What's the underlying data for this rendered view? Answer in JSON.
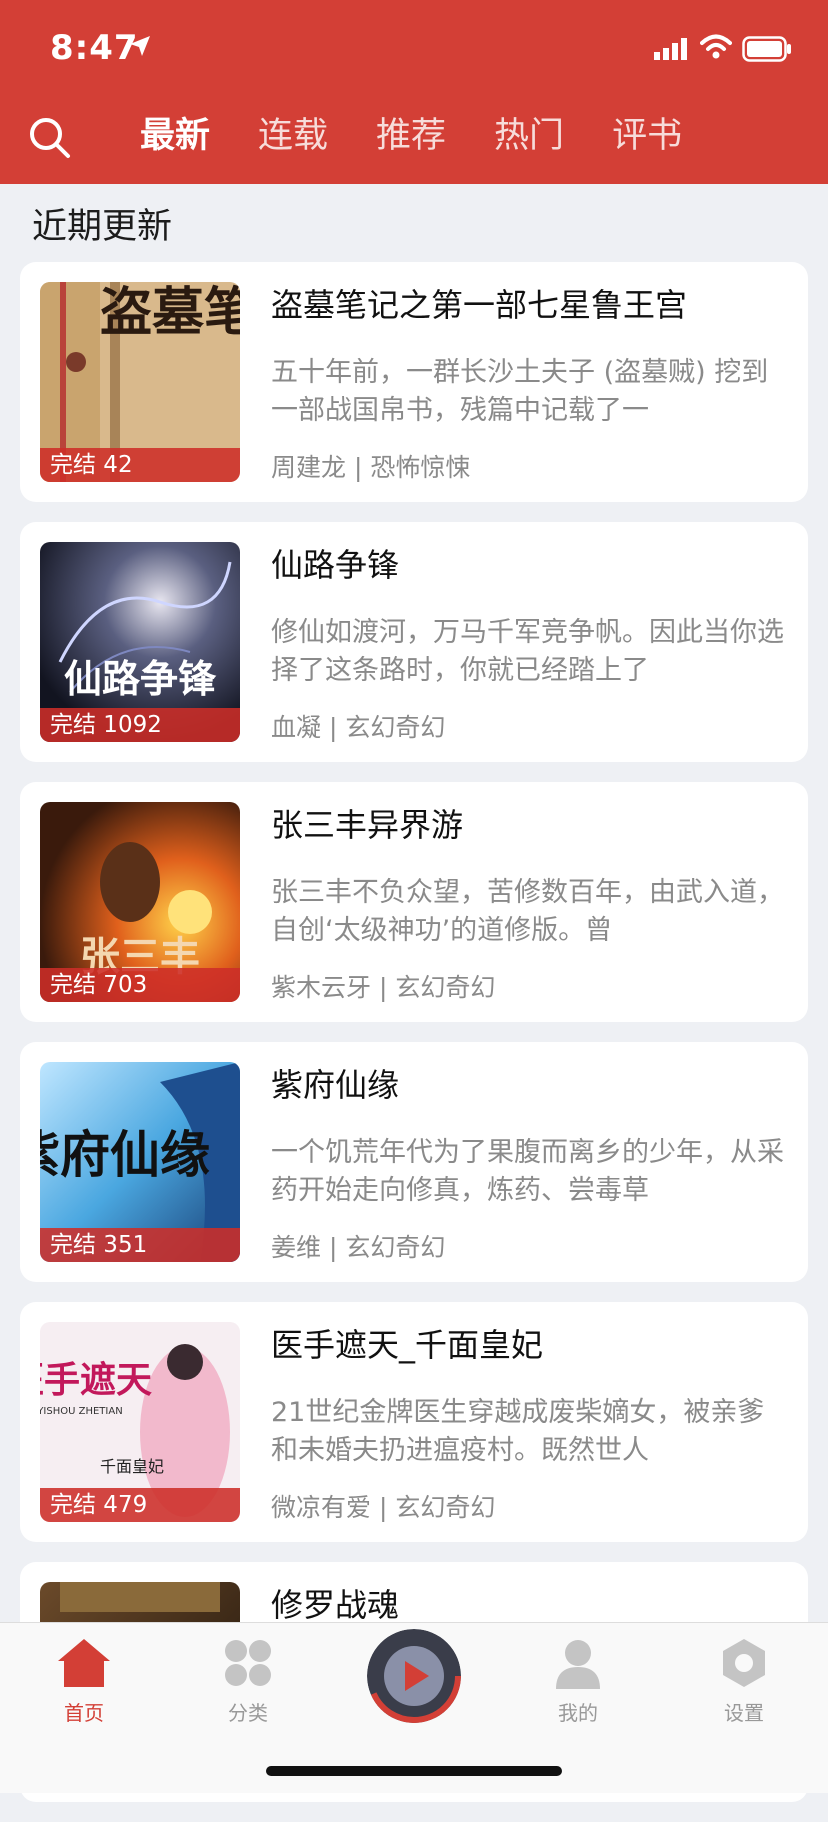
{
  "status_bar": {
    "time": "8:47"
  },
  "nav": {
    "tabs": [
      {
        "label": "最新",
        "active": true
      },
      {
        "label": "连载",
        "active": false
      },
      {
        "label": "推荐",
        "active": false
      },
      {
        "label": "热门",
        "active": false
      },
      {
        "label": "评书",
        "active": false
      }
    ]
  },
  "section": {
    "title": "近期更新"
  },
  "books": [
    {
      "title": "盗墓笔记之第一部七星鲁王宫",
      "desc": "五十年前，一群长沙土夫子 (盗墓贼) 挖到一部战国帛书，残篇中记载了一",
      "author": "周建龙",
      "genre": "恐怖惊悚",
      "status": "完结 42",
      "cover_text": "盗墓笔"
    },
    {
      "title": "仙路争锋",
      "desc": "修仙如渡河，万马千军竞争帆。因此当你选择了这条路时，你就已经踏上了",
      "author": "血凝",
      "genre": "玄幻奇幻",
      "status": "完结 1092",
      "cover_text": "仙路争锋"
    },
    {
      "title": "张三丰异界游",
      "desc": "张三丰不负众望，苦修数百年，由武入道，自创‘太级神功’的道修版。曾",
      "author": "紫木云牙",
      "genre": "玄幻奇幻",
      "status": "完结 703",
      "cover_text": "张三丰"
    },
    {
      "title": "紫府仙缘",
      "desc": "一个饥荒年代为了果腹而离乡的少年，从采药开始走向修真，炼药、尝毒草",
      "author": "姜维",
      "genre": "玄幻奇幻",
      "status": "完结 351",
      "cover_text": "紫府仙缘"
    },
    {
      "title": "医手遮天_千面皇妃",
      "desc": "21世纪金牌医生穿越成废柴嫡女，被亲爹和未婚夫扔进瘟疫村。既然世人",
      "author": "微凉有爱",
      "genre": "玄幻奇幻",
      "status": "完结 479",
      "cover_text": "医手遮天",
      "cover_subtext": "YISHOU ZHETIAN",
      "cover_subtitle": "千面皇妃"
    },
    {
      "title": "修罗战魂",
      "desc": "",
      "author": "",
      "genre": "",
      "status": "",
      "cover_text": ""
    }
  ],
  "bottom_nav": [
    {
      "label": "首页",
      "icon": "home-icon",
      "active": true
    },
    {
      "label": "分类",
      "icon": "category-icon",
      "active": false
    },
    {
      "label": "",
      "icon": "now-playing-disc-icon",
      "active": false
    },
    {
      "label": "我的",
      "icon": "user-icon",
      "active": false
    },
    {
      "label": "设置",
      "icon": "settings-icon",
      "active": false
    }
  ],
  "colors": {
    "brand": "#d33f36",
    "background": "#eef0f4",
    "muted": "#8a8a8a"
  }
}
